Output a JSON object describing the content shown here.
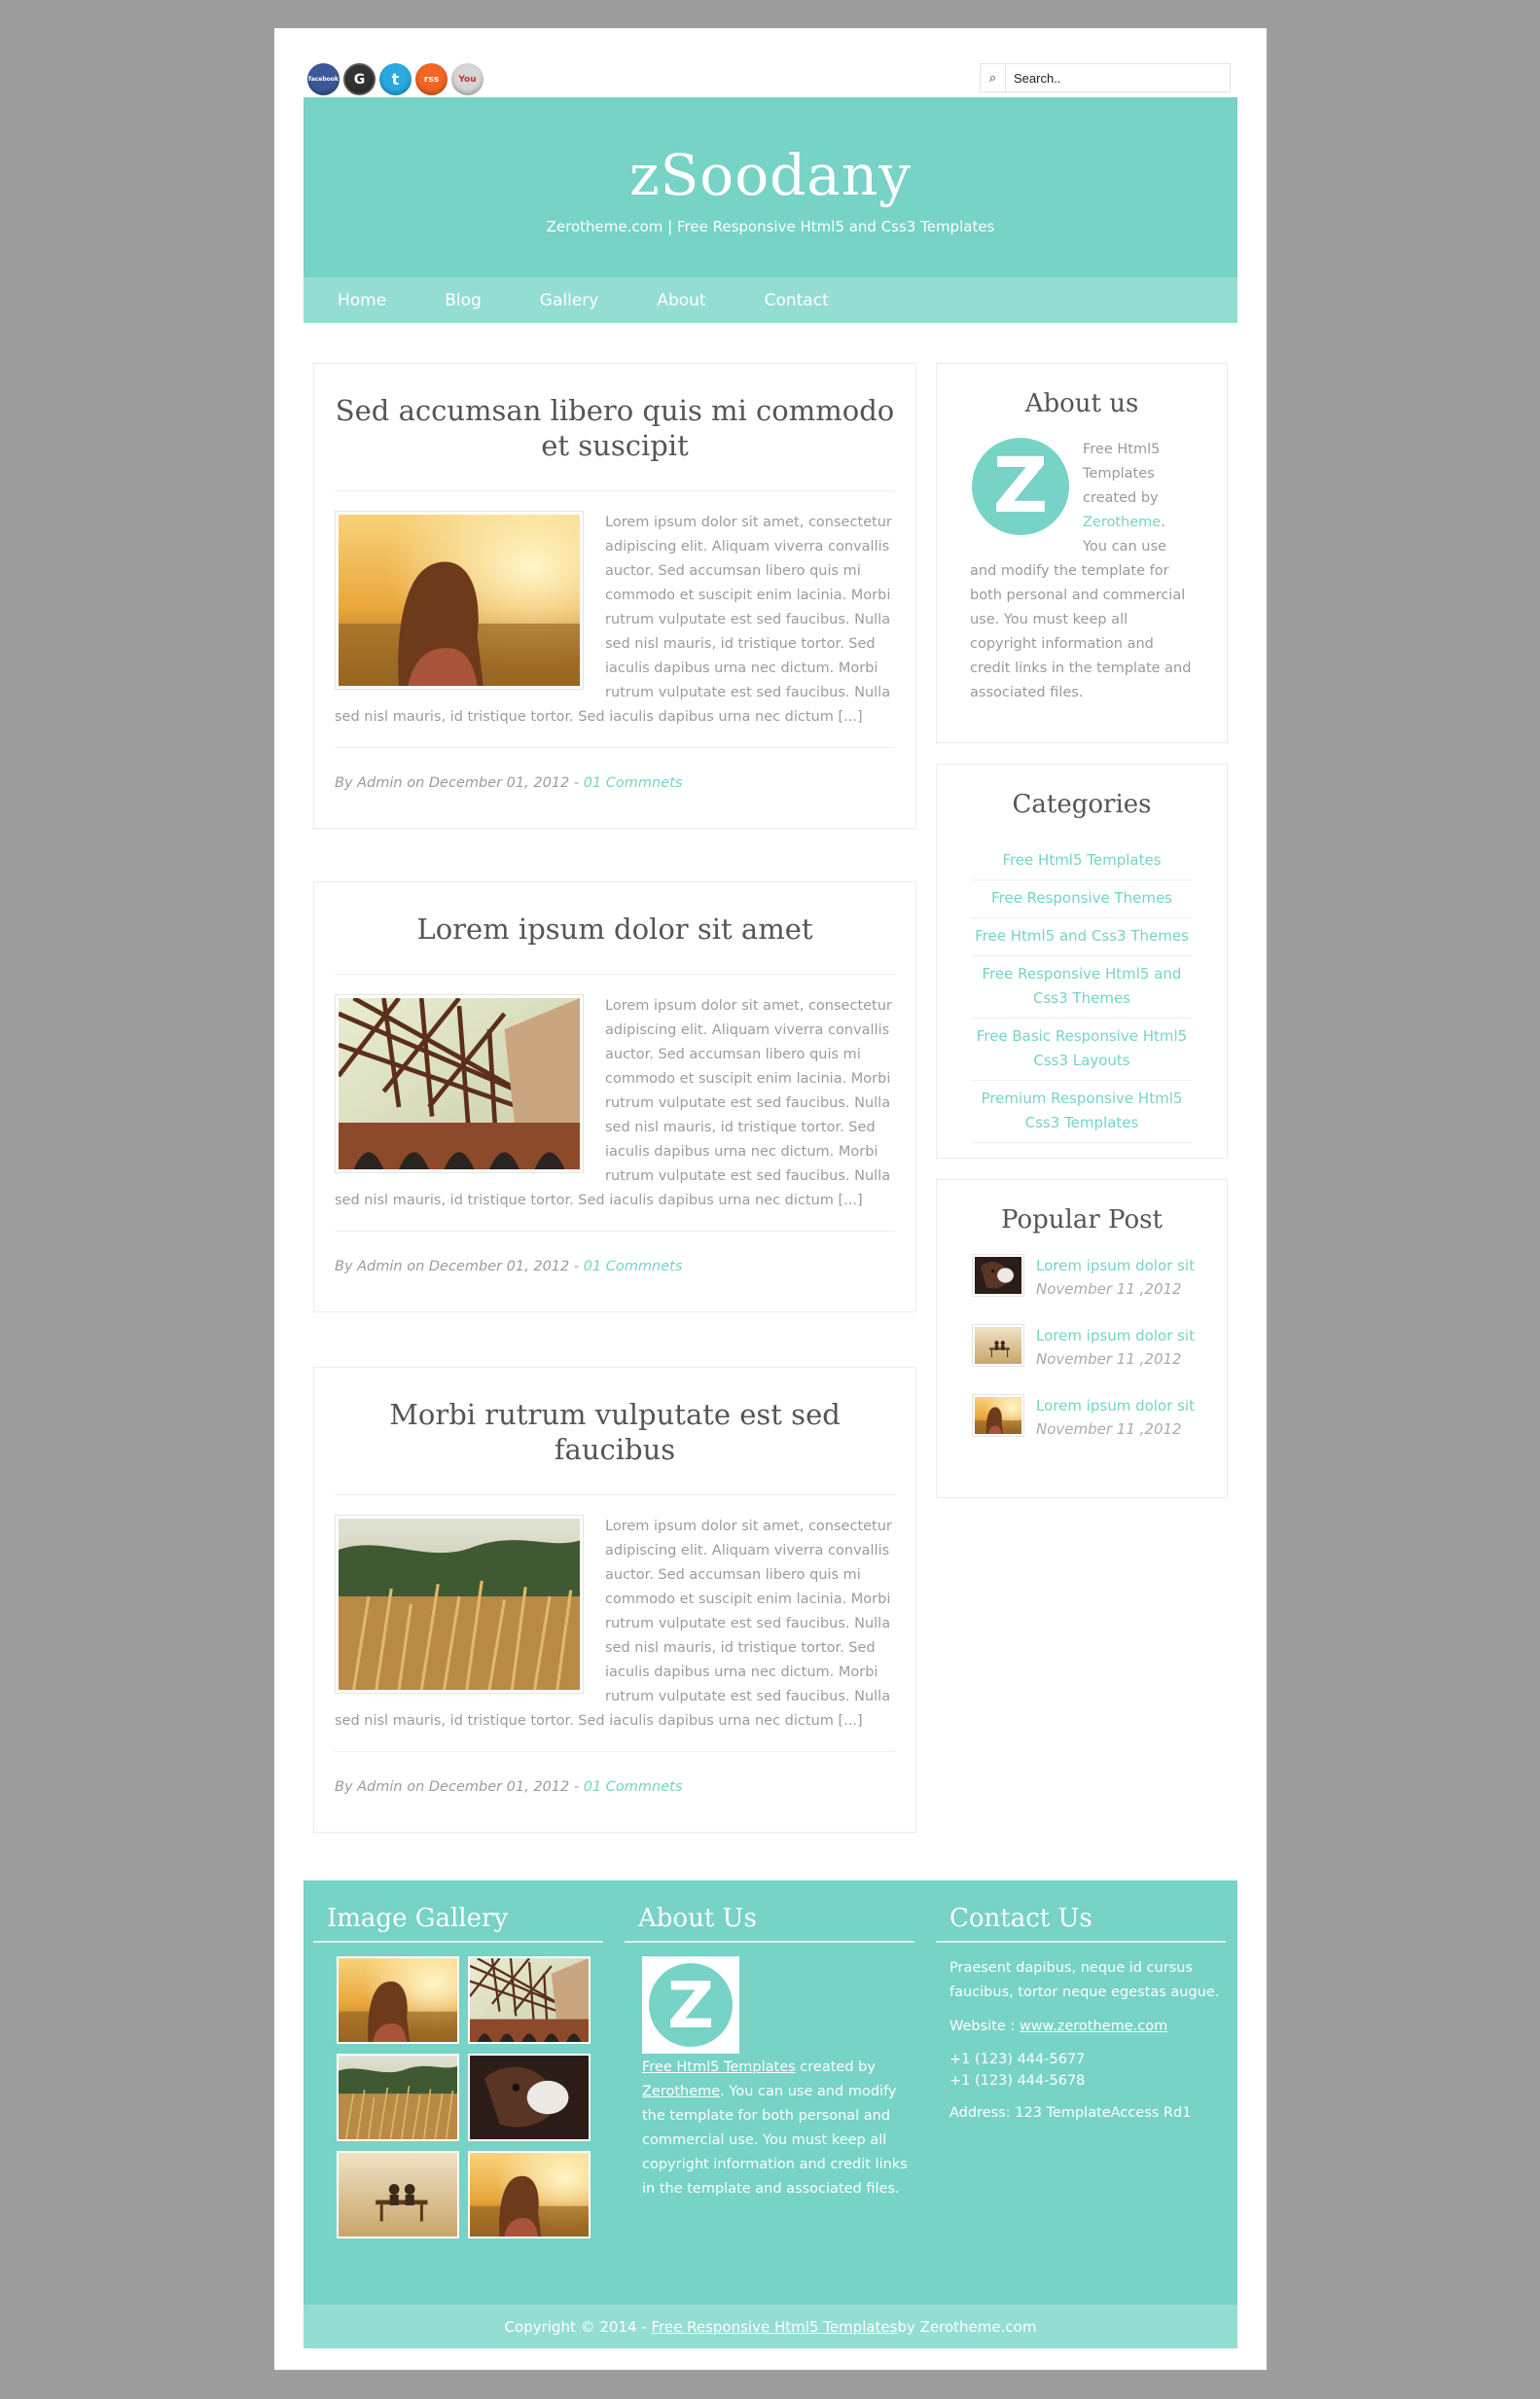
{
  "social": [
    {
      "name": "facebook",
      "label": "facebook",
      "color": "#3b5998"
    },
    {
      "name": "google",
      "label": "G",
      "color": "#333333"
    },
    {
      "name": "twitter",
      "label": "t",
      "color": "#2aa9e0"
    },
    {
      "name": "rss",
      "label": "rss",
      "color": "#f26522"
    },
    {
      "name": "youtube",
      "label": "You",
      "color": "#d0d0d0"
    }
  ],
  "search": {
    "placeholder": "Search.."
  },
  "header": {
    "title": "zSoodany",
    "tagline": "Zerotheme.com | Free Responsive Html5 and Css3 Templates"
  },
  "nav": [
    "Home",
    "Blog",
    "Gallery",
    "About",
    "Contact"
  ],
  "posts": [
    {
      "title": "Sed accumsan libero quis mi commodo et suscipit",
      "body": "Lorem ipsum dolor sit amet, consectetur adipiscing elit. Aliquam viverra convallis auctor. Sed accumsan libero quis mi commodo et suscipit enim lacinia. Morbi rutrum vulputate est sed faucibus. Nulla sed nisl mauris, id tristique tortor. Sed iaculis dapibus urna nec dictum. Morbi rutrum vulputate est sed faucibus. Nulla sed nisl mauris, id tristique tortor. Sed iaculis dapibus urna nec dictum [...]",
      "meta": "By Admin on December 01, 2012 - ",
      "comments": "01 Commnets"
    },
    {
      "title": "Lorem ipsum dolor sit amet",
      "body": "Lorem ipsum dolor sit amet, consectetur adipiscing elit. Aliquam viverra convallis auctor. Sed accumsan libero quis mi commodo et suscipit enim lacinia. Morbi rutrum vulputate est sed faucibus. Nulla sed nisl mauris, id tristique tortor. Sed iaculis dapibus urna nec dictum. Morbi rutrum vulputate est sed faucibus. Nulla sed nisl mauris, id tristique tortor. Sed iaculis dapibus urna nec dictum [...]",
      "meta": "By Admin on December 01, 2012 - ",
      "comments": "01 Commnets"
    },
    {
      "title": "Morbi rutrum vulputate est sed faucibus",
      "body": "Lorem ipsum dolor sit amet, consectetur adipiscing elit. Aliquam viverra convallis auctor. Sed accumsan libero quis mi commodo et suscipit enim lacinia. Morbi rutrum vulputate est sed faucibus. Nulla sed nisl mauris, id tristique tortor. Sed iaculis dapibus urna nec dictum. Morbi rutrum vulputate est sed faucibus. Nulla sed nisl mauris, id tristique tortor. Sed iaculis dapibus urna nec dictum [...]",
      "meta": "By Admin on December 01, 2012 - ",
      "comments": "01 Commnets"
    }
  ],
  "sidebar": {
    "about": {
      "title": "About us",
      "logo": "Z",
      "text_before": "Free Html5 Templates created by ",
      "link": "Zerotheme",
      "text_after": ". You can use and modify the template for both personal and commercial use. You must keep all copyright information and credit links in the template and associated files."
    },
    "categories": {
      "title": "Categories",
      "items": [
        "Free Html5 Templates",
        "Free Responsive Themes",
        "Free Html5 and Css3 Themes",
        "Free Responsive Html5 and Css3 Themes",
        "Free Basic Responsive Html5 Css3 Layouts",
        "Premium Responsive Html5 Css3 Templates"
      ]
    },
    "popular": {
      "title": "Popular Post",
      "items": [
        {
          "title": "Lorem ipsum dolor sit",
          "date": "November 11 ,2012"
        },
        {
          "title": "Lorem ipsum dolor sit",
          "date": "November 11 ,2012"
        },
        {
          "title": "Lorem ipsum dolor sit",
          "date": "November 11 ,2012"
        }
      ]
    }
  },
  "footer": {
    "gallery_title": "Image Gallery",
    "about": {
      "title": "About Us",
      "logo": "Z",
      "link1": "Free Html5 Templates",
      "text1": " created by ",
      "link2": "Zerotheme",
      "text2": ". You can use and modify the template for both personal and commercial use. You must keep all copyright information and credit links in the template and associated files."
    },
    "contact": {
      "title": "Contact Us",
      "intro": "Praesent dapibus, neque id cursus faucibus, tortor neque egestas augue.",
      "website_label": "Website : ",
      "website": "www.zerotheme.com",
      "phone1": "+1 (123) 444-5677",
      "phone2": "+1 (123) 444-5678",
      "address": "Address: 123 TemplateAccess Rd1"
    },
    "copyright_prefix": "Copyright © 2014 - ",
    "copyright_link": "Free Responsive Html5 Templates",
    "copyright_suffix": " by Zerotheme.com"
  },
  "colors": {
    "accent": "#76d3c5",
    "accent_light": "#94ddd2",
    "background": "#9d9d9d"
  }
}
